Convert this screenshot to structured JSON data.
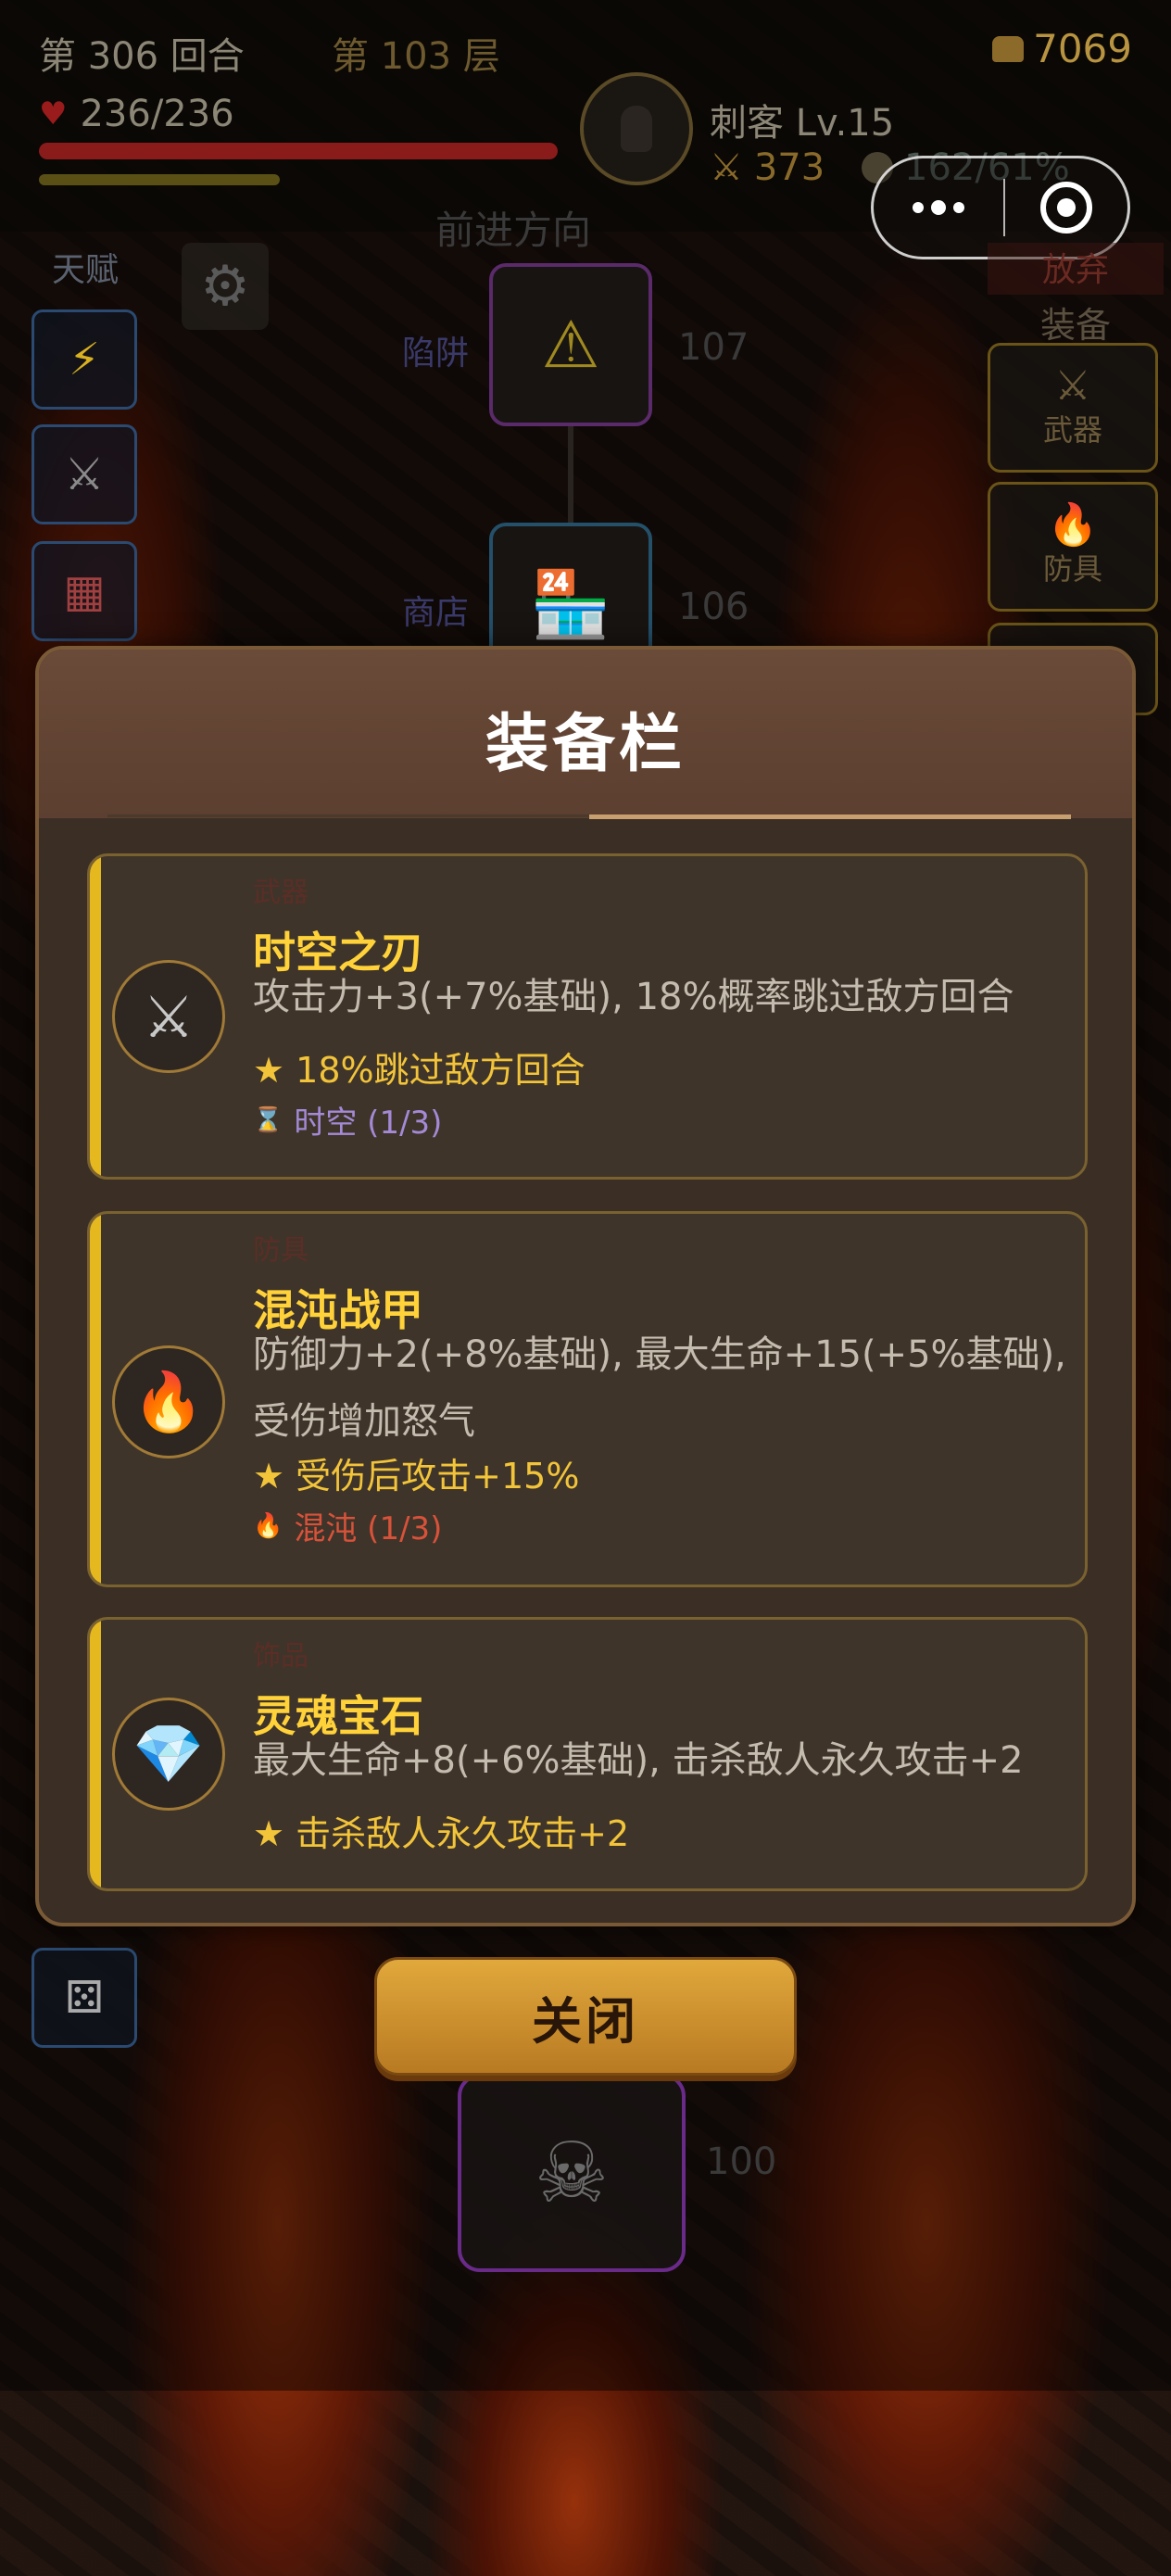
{
  "hud": {
    "turn": "第 306 回合",
    "floor": "第 103 层",
    "gold": "7069",
    "hp": "236/236",
    "hp_fraction": 1.0,
    "character": "刺客 Lv.15",
    "attack": "373",
    "exp": "162/61%"
  },
  "left": {
    "talent": "天赋",
    "buttons": [
      "lightning-icon",
      "crossed-swords-icon",
      "book-icon"
    ],
    "dice": "dice-icon"
  },
  "route": {
    "title": "前进方向",
    "nodes": [
      {
        "label": "陷阱",
        "num": "107",
        "icon": "warning-icon",
        "glyph": "⚠"
      },
      {
        "label": "商店",
        "num": "106",
        "icon": "shop-icon",
        "glyph": "🏪"
      }
    ],
    "boss_num": "100",
    "boss_glyph": "☠"
  },
  "right": {
    "abandon": "放弃",
    "equip": "装备",
    "slots": [
      {
        "label": "武器",
        "glyph": "⚔"
      },
      {
        "label": "防具",
        "glyph": "🔥"
      }
    ]
  },
  "modal": {
    "title": "装备栏",
    "close": "关闭",
    "items": [
      {
        "type": "武器",
        "name": "时空之刃",
        "icon": "crossed-swords-icon",
        "glyph": "⚔",
        "desc": "攻击力+3(+7%基础), 18%概率跳过敌方回合",
        "effect": "★ 18%跳过敌方回合",
        "set_icon": "hourglass-icon",
        "set_glyph": "⌛",
        "set": "时空 (1/3)",
        "set_color": "#a48ad6"
      },
      {
        "type": "防具",
        "name": "混沌战甲",
        "icon": "fire-icon",
        "glyph": "🔥",
        "desc": "防御力+2(+8%基础), 最大生命+15(+5%基础), 受伤增加怒气",
        "effect": "★ 受伤后攻击+15%",
        "set_icon": "flame-icon",
        "set_glyph": "🔥",
        "set": "混沌 (1/3)",
        "set_color": "#d8523a"
      },
      {
        "type": "饰品",
        "name": "灵魂宝石",
        "icon": "gem-icon",
        "glyph": "💎",
        "desc": "最大生命+8(+6%基础), 击杀敌人永久攻击+2",
        "effect": "★ 击杀敌人永久攻击+2"
      }
    ]
  },
  "colors": {
    "accent_gold": "#ffd23a",
    "card_bar": "#e6b820",
    "modal_bg": "#3b2e24",
    "button": "#d39a34"
  }
}
